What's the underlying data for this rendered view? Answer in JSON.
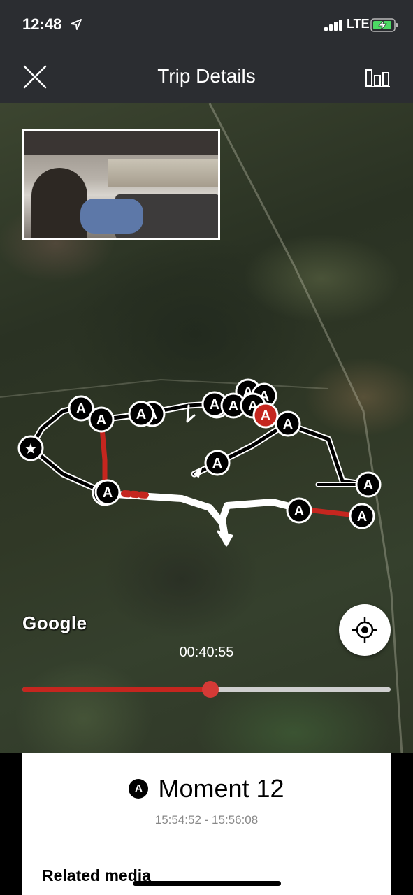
{
  "status_bar": {
    "time": "12:48",
    "network": "LTE",
    "icons": [
      "location-arrow-icon",
      "signal-icon",
      "battery-charging-icon"
    ]
  },
  "nav": {
    "title": "Trip Details",
    "close_icon": "close-icon",
    "stats_icon": "bar-chart-icon"
  },
  "map": {
    "provider": "Google",
    "timestamp": "00:40:55",
    "progress_fraction": 0.51,
    "accent_color": "#c5261f",
    "route_color": "#ffffff",
    "marker_label": "A",
    "start_marker": "★",
    "moment_markers": 18,
    "locate_icon": "crosshair-icon"
  },
  "moment": {
    "badge": "A",
    "title": "Moment 12",
    "time_range": "15:54:52 - 15:56:08"
  },
  "sheet": {
    "related_label": "Related media"
  }
}
